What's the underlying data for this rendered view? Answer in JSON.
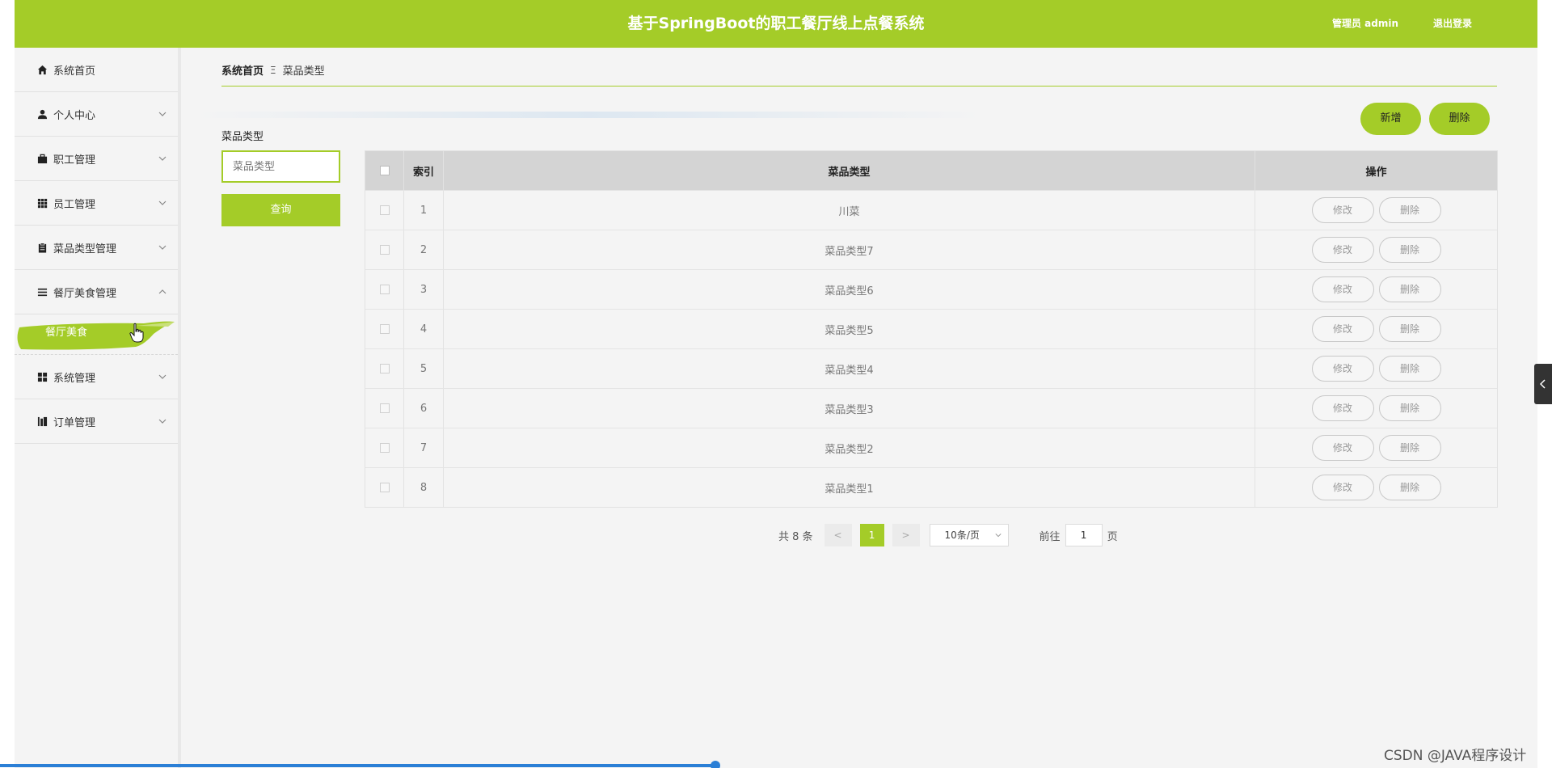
{
  "header": {
    "title": "基于SpringBoot的职工餐厅线上点餐系统",
    "admin": "管理员 admin",
    "logout": "退出登录"
  },
  "sidebar": {
    "items": [
      {
        "label": "系统首页",
        "icon": "home-icon"
      },
      {
        "label": "个人中心",
        "icon": "user-icon"
      },
      {
        "label": "职工管理",
        "icon": "briefcase-icon"
      },
      {
        "label": "员工管理",
        "icon": "grid-icon"
      },
      {
        "label": "菜品类型管理",
        "icon": "clipboard-icon"
      },
      {
        "label": "餐厅美食管理",
        "icon": "list-icon"
      },
      {
        "label": "系统管理",
        "icon": "apps-icon"
      },
      {
        "label": "订单管理",
        "icon": "chart-icon"
      }
    ],
    "submenu": {
      "label": "餐厅美食"
    }
  },
  "breadcrumb": {
    "home": "系统首页",
    "separator": "Ξ",
    "current": "菜品类型"
  },
  "search": {
    "label": "菜品类型",
    "placeholder": "菜品类型",
    "button": "查询"
  },
  "toolbar": {
    "add": "新增",
    "delete": "删除"
  },
  "table": {
    "headers": {
      "index": "索引",
      "name": "菜品类型",
      "ops": "操作"
    },
    "rows": [
      {
        "index": "1",
        "name": "川菜"
      },
      {
        "index": "2",
        "name": "菜品类型7"
      },
      {
        "index": "3",
        "name": "菜品类型6"
      },
      {
        "index": "4",
        "name": "菜品类型5"
      },
      {
        "index": "5",
        "name": "菜品类型4"
      },
      {
        "index": "6",
        "name": "菜品类型3"
      },
      {
        "index": "7",
        "name": "菜品类型2"
      },
      {
        "index": "8",
        "name": "菜品类型1"
      }
    ],
    "edit": "修改",
    "delete": "删除"
  },
  "pagination": {
    "total": "共 8 条",
    "prev": "<",
    "current": "1",
    "next": ">",
    "page_size": "10条/页",
    "goto_label": "前往",
    "goto_value": "1",
    "page_word": "页"
  },
  "watermark": "CSDN @JAVA程序设计",
  "colors": {
    "accent": "#a4cc28",
    "header_bg": "#a4cc28",
    "table_header": "#d4d4d4"
  }
}
